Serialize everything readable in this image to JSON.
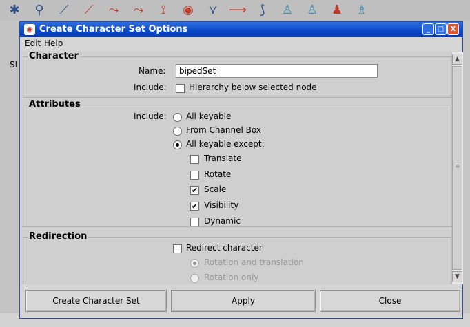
{
  "background": {
    "left_strip_text": "Sl"
  },
  "window": {
    "title": "Create Character Set Options",
    "minimize_label": "_",
    "maximize_label": "□",
    "close_label": "X",
    "menu": [
      "Edit",
      "Help"
    ],
    "sections": {
      "character": {
        "title": "Character",
        "name_label": "Name:",
        "name_value": "bipedSet",
        "include_label": "Include:",
        "hierarchy_label": "Hierarchy below selected node",
        "hierarchy_checked": false
      },
      "attributes": {
        "title": "Attributes",
        "include_label": "Include:",
        "radio_all_keyable": "All keyable",
        "radio_channel_box": "From Channel Box",
        "radio_all_except": "All keyable except:",
        "selected_radio": "All keyable except:",
        "except_options": [
          {
            "label": "Translate",
            "checked": false
          },
          {
            "label": "Rotate",
            "checked": false
          },
          {
            "label": "Scale",
            "checked": true
          },
          {
            "label": "Visibility",
            "checked": true
          },
          {
            "label": "Dynamic",
            "checked": false
          }
        ]
      },
      "redirection": {
        "title": "Redirection",
        "redirect_label": "Redirect character",
        "redirect_checked": false,
        "radio_rot_trans": "Rotation and translation",
        "radio_rot_only": "Rotation only",
        "selected_radio": "Rotation and translation"
      }
    },
    "buttons": {
      "create": "Create Character Set",
      "apply": "Apply",
      "close": "Close"
    }
  },
  "colors": {
    "titlebar": "#0a47c8",
    "window_bg": "#d6d6d6",
    "close_button": "#d9532b"
  }
}
